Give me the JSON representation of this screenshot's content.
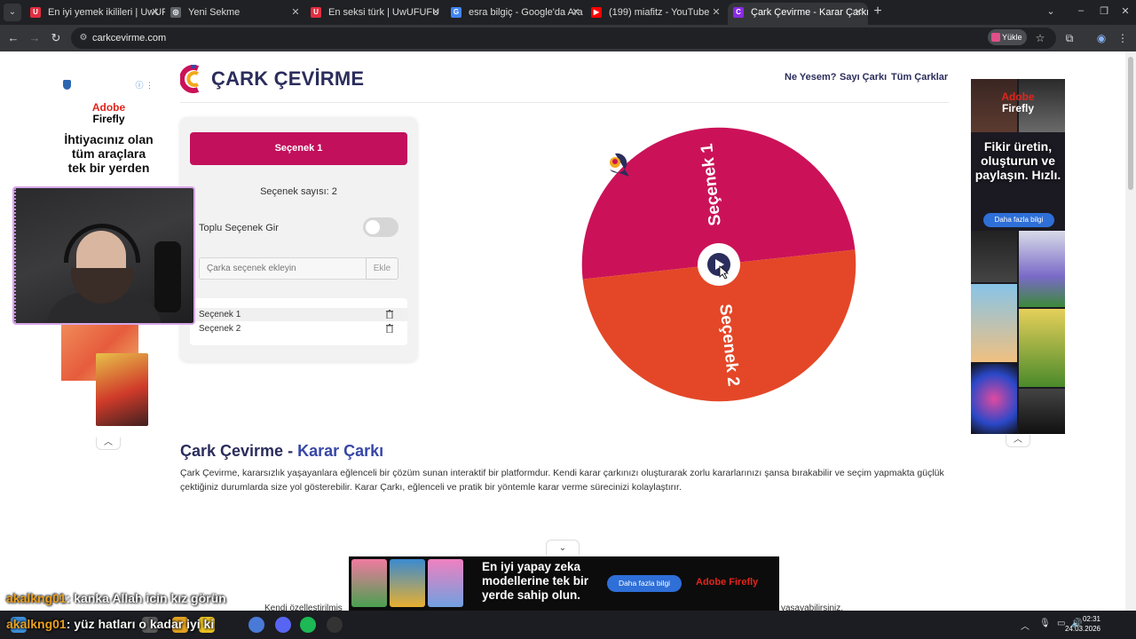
{
  "browser": {
    "tabs": [
      {
        "title": "En iyi yemek ikilileri | UwUFUFU",
        "favicon": "uwufufu-icon",
        "color": "#e32d40",
        "glyph": "U"
      },
      {
        "title": "Yeni Sekme",
        "favicon": "chrome-icon",
        "color": "#5f6368",
        "glyph": "◎"
      },
      {
        "title": "En seksi türk | UwUFUFU",
        "favicon": "uwufufu-icon",
        "color": "#e32d40",
        "glyph": "U"
      },
      {
        "title": "esra bilgiç - Google'da Ara",
        "favicon": "google-icon",
        "color": "#4285f4",
        "glyph": "G"
      },
      {
        "title": "(199) miafitz - YouTube",
        "favicon": "youtube-icon",
        "color": "#ff0000",
        "glyph": "▶"
      },
      {
        "title": "Çark Çevirme - Karar Çarkı",
        "favicon": "cark-icon",
        "color": "#8a2be2",
        "glyph": "C"
      }
    ],
    "url": "carkcevirme.com",
    "upload_label": "Yükle"
  },
  "site": {
    "title": "ÇARK ÇEVİRME",
    "nav": [
      "Ne Yesem?",
      "Sayı Çarkı",
      "Tüm Çarklar"
    ]
  },
  "panel": {
    "selected_label": "Seçenek 1",
    "count_label": "Seçenek sayısı: 2",
    "bulk_label": "Toplu Seçenek Gir",
    "bulk_enabled": false,
    "input_placeholder": "Çarka seçenek ekleyin",
    "add_label": "Ekle",
    "options": [
      "Seçenek 1",
      "Seçenek 2"
    ]
  },
  "wheel": {
    "segments": [
      {
        "label": "Seçenek 1",
        "color": "#cb1258"
      },
      {
        "label": "Seçenek 2",
        "color": "#e44727"
      }
    ],
    "center_color": "#2b2d5c"
  },
  "article": {
    "heading_main": "Çark Çevirme - ",
    "heading_accent": "Karar Çarkı",
    "paragraph": "Çark Çevirme, kararsızlık yaşayanlara eğlenceli bir çözüm sunan interaktif bir platformdur. Kendi karar çarkınızı oluşturarak zorlu kararlarınızı şansa bırakabilir ve seçim yapmakta güçlük çektiğiniz durumlarda size yol gösterebilir. Karar Çarkı, eğlenceli ve pratik bir yöntemle karar verme sürecinizi kolaylaştırır.",
    "partial_left": "Kendi özelleştirilmiş",
    "partial_right": "yaşayabilirsiniz."
  },
  "ads": {
    "left": {
      "brand_line1": "Adobe",
      "brand_line2": "Firefly",
      "headline": "İhtiyacınız olan tüm araçlara tek bir yerden"
    },
    "right": {
      "brand_line1": "Adobe",
      "brand_line2": "Firefly",
      "headline": "Fikir üretin, oluşturun ve paylaşın. Hızlı.",
      "cta": "Daha fazla bilgi"
    },
    "bottom": {
      "headline": "En iyi yapay zeka modellerine tek bir yerde sahip olun.",
      "cta": "Daha fazla bilgi",
      "brand": "Adobe Firefly"
    }
  },
  "chat": [
    {
      "user": "akalkng01",
      "message": ": kanka Allah icin kız görün"
    },
    {
      "user": "akalkng01",
      "message": ": yüz hatları o kadar iyi ki"
    }
  ],
  "taskbar": {
    "time": "02:31",
    "date": "24.03.2026"
  }
}
